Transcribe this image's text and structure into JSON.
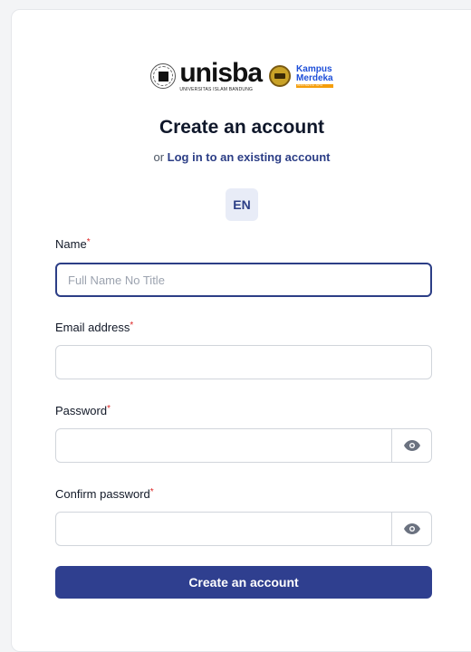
{
  "logo": {
    "brand": "unisba",
    "brand_sub": "UNIVERSITAS ISLAM BANDUNG",
    "partner_line1": "Kampus",
    "partner_line2": "Merdeka",
    "partner_strip": "INDONESIA JAYA"
  },
  "header": {
    "title": "Create an account",
    "subtitle_prefix": "or",
    "login_link": "Log in to an existing account"
  },
  "language": {
    "current": "EN"
  },
  "form": {
    "name": {
      "label": "Name",
      "required_mark": "*",
      "placeholder": "Full Name No Title",
      "value": ""
    },
    "email": {
      "label": "Email address",
      "required_mark": "*",
      "placeholder": "",
      "value": ""
    },
    "password": {
      "label": "Password",
      "required_mark": "*",
      "placeholder": "",
      "value": "",
      "toggle_icon": "eye-icon"
    },
    "confirm_password": {
      "label": "Confirm password",
      "required_mark": "*",
      "placeholder": "",
      "value": "",
      "toggle_icon": "eye-icon"
    },
    "submit_label": "Create an account"
  },
  "colors": {
    "primary": "#2f3f8f",
    "link": "#2c3e86",
    "required": "#dc2626",
    "lang_bg": "#e8ecf7"
  }
}
